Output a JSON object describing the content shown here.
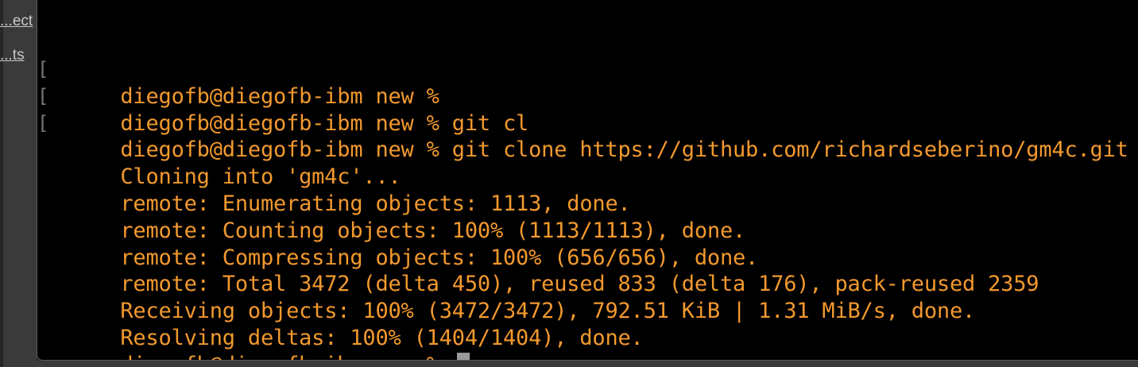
{
  "sidebar": {
    "items": [
      {
        "label": "ect..."
      },
      {
        "label": "ts..."
      }
    ]
  },
  "terminal": {
    "lines": [
      {
        "text": "diegofb@diegofb-ibm new %",
        "marker": "["
      },
      {
        "text": "diegofb@diegofb-ibm new % git cl",
        "marker": "["
      },
      {
        "text": "diegofb@diegofb-ibm new % git clone https://github.com/richardseberino/gm4c.git",
        "marker": "["
      },
      {
        "text": "Cloning into 'gm4c'..."
      },
      {
        "text": "remote: Enumerating objects: 1113, done."
      },
      {
        "text": "remote: Counting objects: 100% (1113/1113), done."
      },
      {
        "text": "remote: Compressing objects: 100% (656/656), done."
      },
      {
        "text": "remote: Total 3472 (delta 450), reused 833 (delta 176), pack-reused 2359"
      },
      {
        "text": "Receiving objects: 100% (3472/3472), 792.51 KiB | 1.31 MiB/s, done."
      },
      {
        "text": "Resolving deltas: 100% (1404/1404), done."
      },
      {
        "text": "diegofb@diegofb-ibm new % "
      }
    ],
    "colors": {
      "text": "#f2992e",
      "background": "#000000",
      "cursor": "#9a9a9a"
    }
  }
}
